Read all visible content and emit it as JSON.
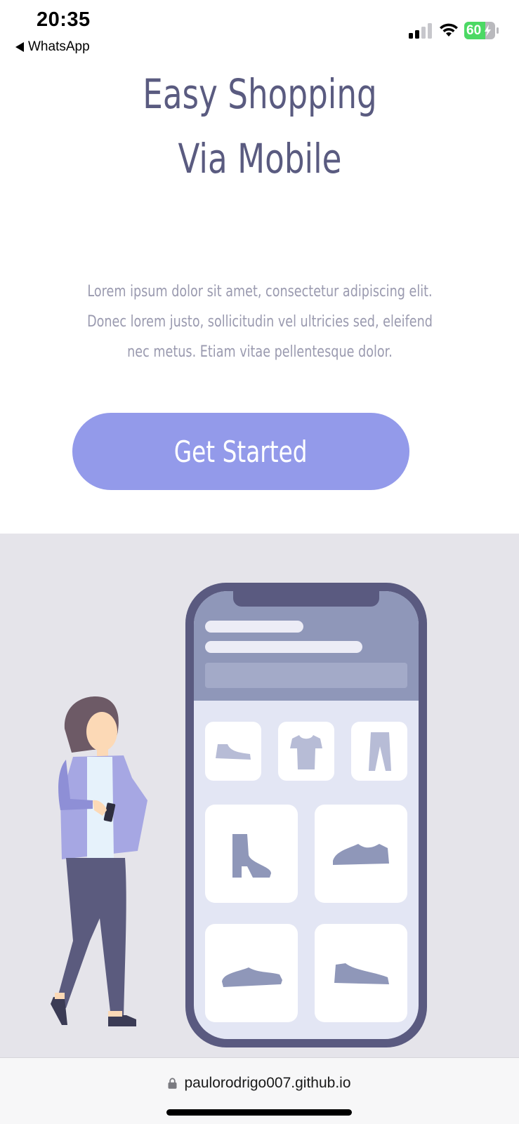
{
  "status_bar": {
    "time": "20:35",
    "back_app": "WhatsApp",
    "battery_level": "60",
    "icons": [
      "back-arrow-icon",
      "cellular-signal-icon",
      "wifi-icon",
      "battery-charging-icon"
    ]
  },
  "hero": {
    "title": "Easy Shopping Via Mobile",
    "description": "Lorem ipsum dolor sit amet, consectetur adipiscing elit. Donec lorem justo, sollicitudin vel ultricies sed, eleifend nec metus. Etiam vitae pellentesque dolor.",
    "cta_label": "Get Started"
  },
  "illustration": {
    "items": [
      "shoe-icon",
      "tshirt-icon",
      "pants-icon",
      "boot-icon",
      "sneaker-icon",
      "sneaker-icon",
      "sneaker-icon"
    ]
  },
  "browser": {
    "url": "paulorodrigo007.github.io"
  },
  "colors": {
    "title": "#5a5b80",
    "body_text": "#9a9aaf",
    "accent": "#939aea",
    "illustration_bg": "#e5e4ea",
    "battery": "#4cd964"
  }
}
